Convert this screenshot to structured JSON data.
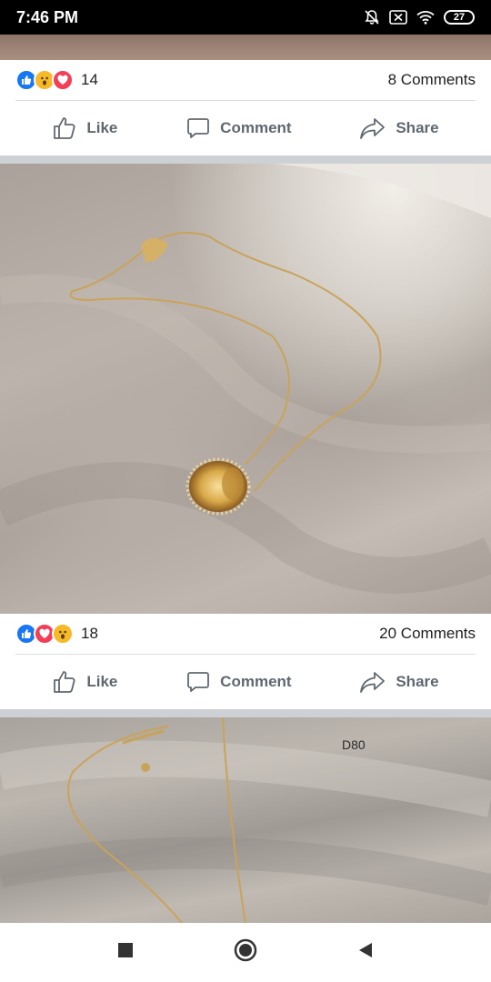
{
  "status_bar": {
    "time": "7:46 PM",
    "battery": "27",
    "icons": [
      "bell-off-icon",
      "close-box-icon",
      "wifi-icon",
      "battery-icon"
    ]
  },
  "posts": [
    {
      "reaction_icons": [
        "like-icon",
        "wow-icon",
        "love-icon"
      ],
      "reaction_count": "14",
      "comments": "8 Comments",
      "actions": {
        "like": "Like",
        "comment": "Comment",
        "share": "Share"
      }
    },
    {
      "reaction_icons": [
        "like-icon",
        "love-icon",
        "wow-icon"
      ],
      "reaction_count": "18",
      "comments": "20 Comments",
      "actions": {
        "like": "Like",
        "comment": "Comment",
        "share": "Share"
      }
    }
  ],
  "bottom_photo": {
    "code": "D80"
  },
  "nav_bar": {
    "icons": [
      "recents-square-icon",
      "home-circle-icon",
      "back-triangle-icon"
    ]
  },
  "colors": {
    "like": "#1877f2",
    "love": "#f33e58",
    "wow": "#f7b928",
    "action_text": "#606770"
  }
}
